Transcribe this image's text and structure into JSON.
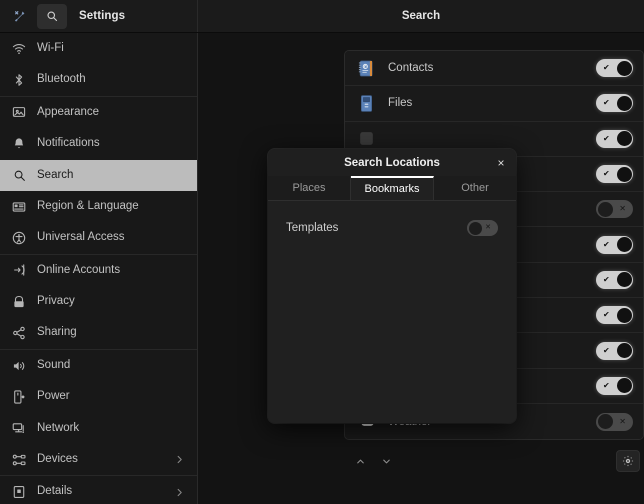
{
  "header": {
    "tools_icon": "wrench-icon",
    "search_icon": "search-icon",
    "title": "Settings",
    "panel_title": "Search"
  },
  "sidebar": {
    "groups": [
      {
        "items": [
          {
            "icon": "wifi-icon",
            "label": "Wi-Fi",
            "selected": false,
            "chevron": false
          },
          {
            "icon": "bluetooth-icon",
            "label": "Bluetooth",
            "selected": false,
            "chevron": false
          }
        ]
      },
      {
        "items": [
          {
            "icon": "appearance-icon",
            "label": "Appearance",
            "selected": false,
            "chevron": false
          },
          {
            "icon": "bell-icon",
            "label": "Notifications",
            "selected": false,
            "chevron": false
          },
          {
            "icon": "search-icon",
            "label": "Search",
            "selected": true,
            "chevron": false
          },
          {
            "icon": "region-icon",
            "label": "Region & Language",
            "selected": false,
            "chevron": false
          },
          {
            "icon": "accessibility-icon",
            "label": "Universal Access",
            "selected": false,
            "chevron": false
          }
        ]
      },
      {
        "items": [
          {
            "icon": "online-accounts-icon",
            "label": "Online Accounts",
            "selected": false,
            "chevron": false
          },
          {
            "icon": "privacy-icon",
            "label": "Privacy",
            "selected": false,
            "chevron": false
          },
          {
            "icon": "sharing-icon",
            "label": "Sharing",
            "selected": false,
            "chevron": false
          }
        ]
      },
      {
        "items": [
          {
            "icon": "sound-icon",
            "label": "Sound",
            "selected": false,
            "chevron": false
          },
          {
            "icon": "power-icon",
            "label": "Power",
            "selected": false,
            "chevron": false
          },
          {
            "icon": "network-icon",
            "label": "Network",
            "selected": false,
            "chevron": false
          },
          {
            "icon": "devices-icon",
            "label": "Devices",
            "selected": false,
            "chevron": true
          }
        ]
      },
      {
        "items": [
          {
            "icon": "details-icon",
            "label": "Details",
            "selected": false,
            "chevron": true
          }
        ]
      }
    ]
  },
  "search_panel": {
    "rows": [
      {
        "icon": "contacts-icon",
        "label": "Contacts",
        "enabled": true
      },
      {
        "icon": "files-icon",
        "label": "Files",
        "enabled": true
      },
      {
        "icon": "app-icon",
        "label": "",
        "enabled": true
      },
      {
        "icon": "app-icon",
        "label": "",
        "enabled": true
      },
      {
        "icon": "app-icon",
        "label": "",
        "enabled": false
      },
      {
        "icon": "app-icon",
        "label": "",
        "enabled": true
      },
      {
        "icon": "app-icon",
        "label": "",
        "enabled": true
      },
      {
        "icon": "app-icon",
        "label": "",
        "enabled": true
      },
      {
        "icon": "app-icon",
        "label": "",
        "enabled": true
      },
      {
        "icon": "app-icon",
        "label": "",
        "enabled": true
      },
      {
        "icon": "weather-icon",
        "label": "Weather",
        "enabled": false
      }
    ],
    "toolbar": {
      "move_up_icon": "chevron-up-icon",
      "move_down_icon": "chevron-down-icon",
      "settings_icon": "gear-icon"
    }
  },
  "dialog": {
    "title": "Search Locations",
    "close_label": "×",
    "tabs": [
      {
        "label": "Places",
        "active": false
      },
      {
        "label": "Bookmarks",
        "active": true
      },
      {
        "label": "Other",
        "active": false
      }
    ],
    "rows": [
      {
        "label": "Templates",
        "enabled": false
      }
    ]
  },
  "colors": {
    "window_bg": "#131313",
    "sidebar_bg": "#181818",
    "header_bg": "#1b1b1b",
    "selected_bg": "#bcbcbc",
    "dialog_bg": "#202020",
    "toggle_on": "#cfcfcf",
    "toggle_off": "#4a4a4a",
    "text": "#c9c9c9"
  }
}
